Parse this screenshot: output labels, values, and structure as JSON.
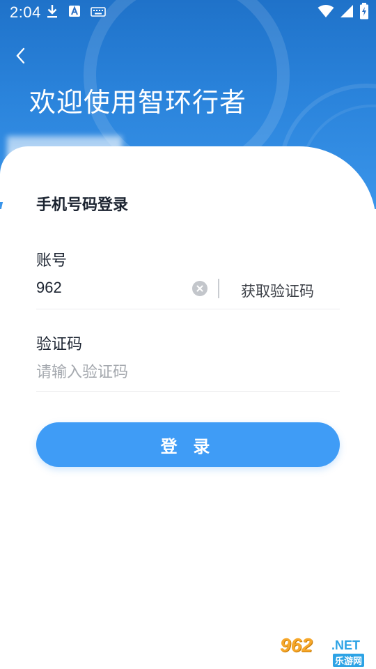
{
  "status_bar": {
    "time": "2:04",
    "left_icons": [
      "download-icon",
      "text-a-icon",
      "keyboard-icon"
    ],
    "right_icons": [
      "wifi-icon",
      "signal-icon",
      "battery-charging-icon"
    ]
  },
  "header": {
    "title": "欢迎使用智环行者",
    "back_icon": "chevron-left-icon"
  },
  "form": {
    "title": "手机号码登录",
    "account_label": "账号",
    "account_value": "962",
    "clear_icon": "clear-circle-icon",
    "get_code_label": "获取验证码",
    "code_label": "验证码",
    "code_placeholder": "请输入验证码",
    "login_label": "登 录"
  },
  "watermark": {
    "digits": "962",
    "suffix": ".NET",
    "subtitle": "乐游网"
  },
  "colors": {
    "header_blue": "#2a83db",
    "button_blue": "#3f9cf6",
    "text_dark": "#1b2330",
    "placeholder": "#a4a8ae"
  }
}
